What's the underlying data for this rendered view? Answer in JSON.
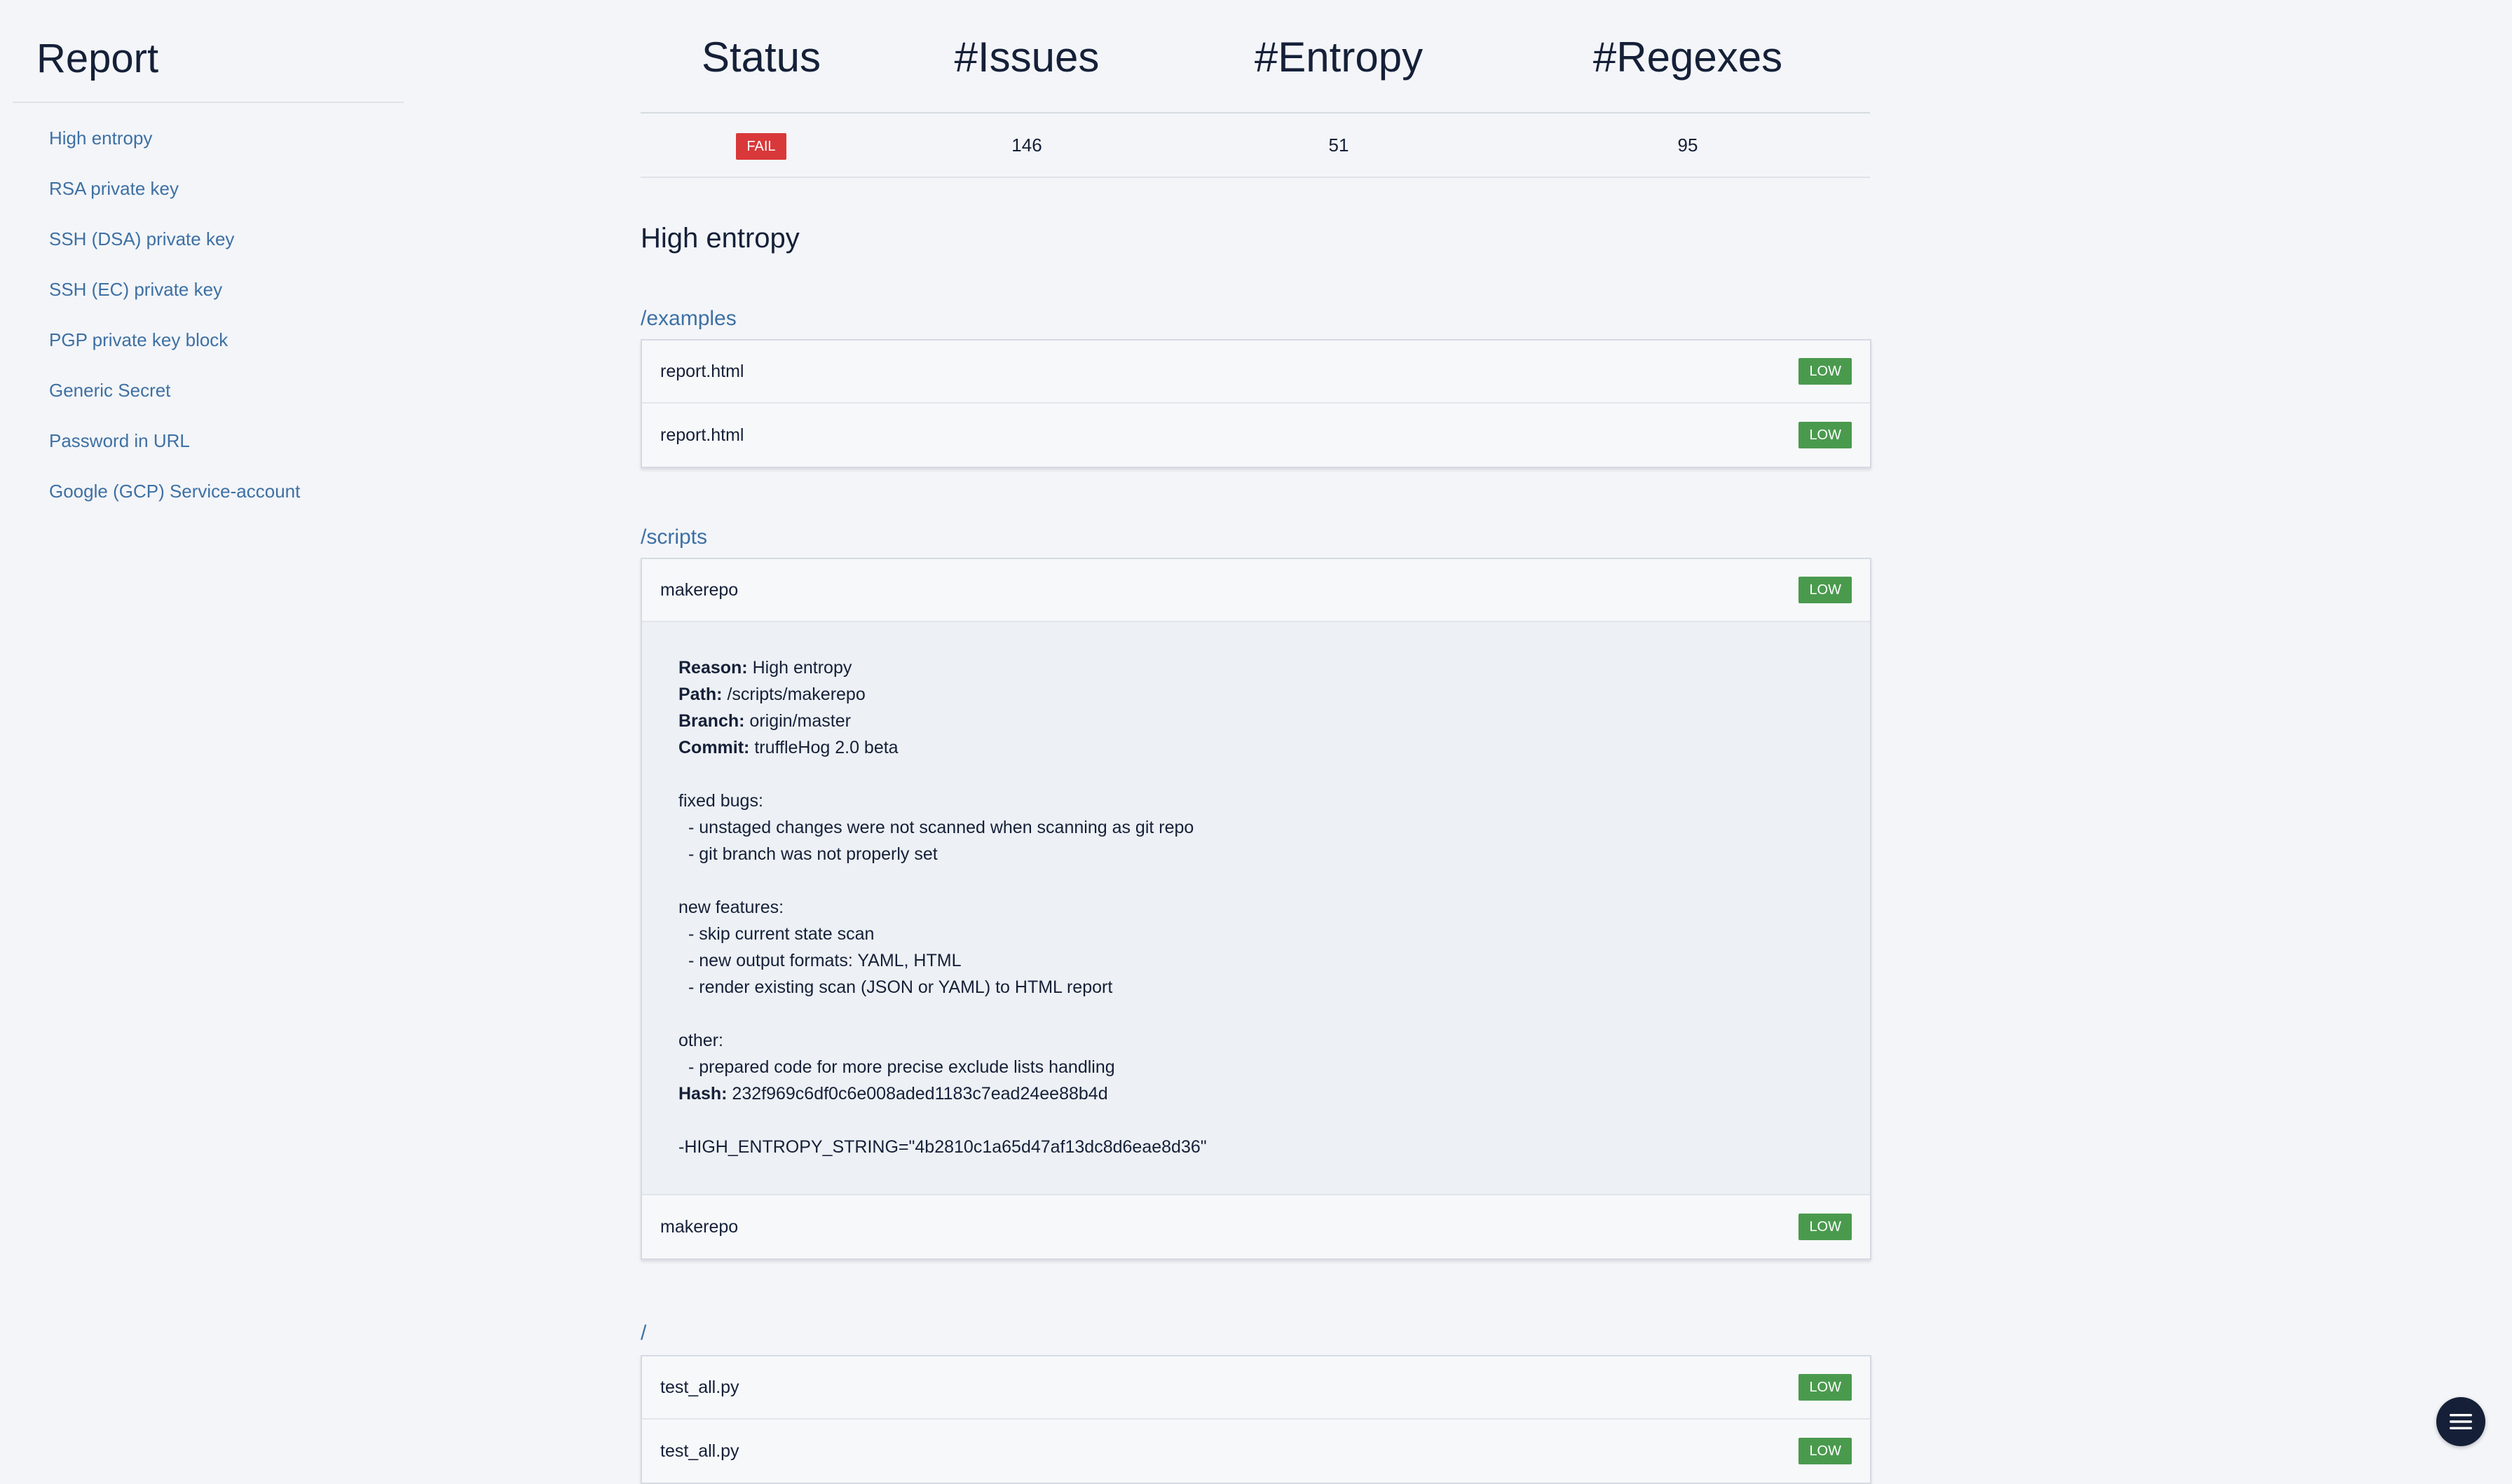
{
  "sidebar": {
    "title": "Report",
    "items": [
      {
        "label": "High entropy"
      },
      {
        "label": "RSA private key"
      },
      {
        "label": "SSH (DSA) private key"
      },
      {
        "label": "SSH (EC) private key"
      },
      {
        "label": "PGP private key block"
      },
      {
        "label": "Generic Secret"
      },
      {
        "label": "Password in URL"
      },
      {
        "label": "Google (GCP) Service-account"
      }
    ]
  },
  "summary": {
    "headers": [
      "Status",
      "#Issues",
      "#Entropy",
      "#Regexes"
    ],
    "status": "FAIL",
    "issues": "146",
    "entropy": "51",
    "regexes": "95"
  },
  "section": {
    "title": "High entropy"
  },
  "groups": [
    {
      "path": "/examples",
      "rows": [
        {
          "name": "report.html",
          "badge": "LOW"
        },
        {
          "name": "report.html",
          "badge": "LOW"
        }
      ]
    },
    {
      "path": "/scripts",
      "rows": [
        {
          "name": "makerepo",
          "badge": "LOW"
        },
        {
          "name": "makerepo",
          "badge": "LOW"
        }
      ],
      "detail": {
        "reason_label": "Reason:",
        "reason": "High entropy",
        "path_label": "Path:",
        "path": "/scripts/makerepo",
        "branch_label": "Branch:",
        "branch": "origin/master",
        "commit_label": "Commit:",
        "commit": "truffleHog 2.0 beta",
        "lines": {
          "fixed": "fixed bugs:",
          "fixed_1": "- unstaged changes were not scanned when scanning as git repo",
          "fixed_2": "- git branch was not properly set",
          "new": "new features:",
          "new_1": "- skip current state scan",
          "new_2": "- new output formats: YAML, HTML",
          "new_3": "- render existing scan (JSON or YAML) to HTML report",
          "other": "other:",
          "other_1": "- prepared code for more precise exclude lists handling"
        },
        "hash_label": "Hash:",
        "hash": "232f969c6df0c6e008aded1183c7ead24ee88b4d",
        "diff_line": "-HIGH_ENTROPY_STRING=\"4b2810c1a65d47af13dc8d6eae8d36\""
      }
    },
    {
      "path": "/",
      "rows": [
        {
          "name": "test_all.py",
          "badge": "LOW"
        },
        {
          "name": "test_all.py",
          "badge": "LOW"
        }
      ]
    }
  ],
  "fab": {
    "icon": "menu-icon"
  },
  "colors": {
    "fail": "#d9383a",
    "low": "#4a9a4e",
    "link": "#3e70a4",
    "text": "#152038",
    "background": "#f3f5f8"
  }
}
